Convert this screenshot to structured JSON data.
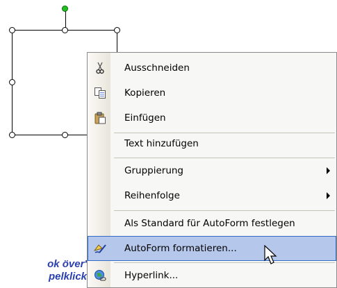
{
  "menu": {
    "items": [
      {
        "label": "Ausschneiden",
        "icon": "scissors-icon"
      },
      {
        "label": "Kopieren",
        "icon": "copy-icon"
      },
      {
        "label": "Einfügen",
        "icon": "paste-icon"
      },
      {
        "label": "Text hinzufügen"
      },
      {
        "label": "Gruppierung",
        "submenu": true
      },
      {
        "label": "Reihenfolge",
        "submenu": true
      },
      {
        "label": "Als Standard für AutoForm festlegen"
      },
      {
        "label": "AutoForm formatieren...",
        "icon": "format-autoshape-icon",
        "highlighted": true
      },
      {
        "label": "Hyperlink...",
        "icon": "hyperlink-globe-icon"
      }
    ]
  },
  "caption": {
    "line1": "ok över't",
    "line2": "pelklick!"
  },
  "colors": {
    "highlight": "#b6c7ec",
    "highlight_border": "#3169c6",
    "caption": "#2a3fb0",
    "rotation_handle": "#22c022"
  }
}
